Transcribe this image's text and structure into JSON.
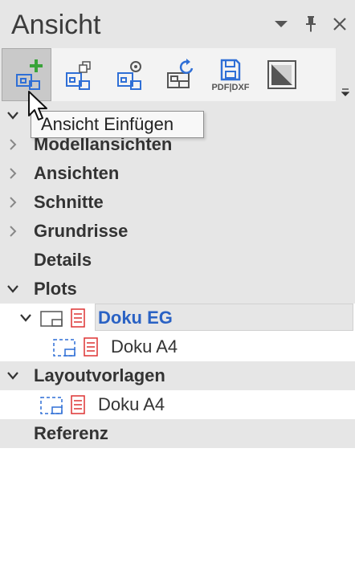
{
  "panel": {
    "title": "Ansicht",
    "controls": {
      "dropdown_icon": "chevron-down-icon",
      "pin_icon": "pin-icon",
      "close_icon": "close-icon"
    }
  },
  "toolbar": {
    "buttons": [
      {
        "name": "insert-view",
        "icon": "view-add-icon",
        "active": true
      },
      {
        "name": "copy-view",
        "icon": "view-copy-icon"
      },
      {
        "name": "view-settings",
        "icon": "view-settings-icon"
      },
      {
        "name": "refresh-view",
        "icon": "view-refresh-icon"
      },
      {
        "name": "export-pdf-dxf",
        "icon": "save-icon",
        "label": "PDF|DXF"
      },
      {
        "name": "view-style",
        "icon": "style-icon"
      }
    ]
  },
  "tooltip": {
    "text": "Ansicht Einfügen"
  },
  "tree": {
    "items": [
      {
        "label": "",
        "expanded": true
      },
      {
        "label": "Modellansichten",
        "expanded": false
      },
      {
        "label": "Ansichten",
        "expanded": false
      },
      {
        "label": "Schnitte",
        "expanded": false
      },
      {
        "label": "Grundrisse",
        "expanded": false
      },
      {
        "label": "Details"
      },
      {
        "label": "Plots",
        "expanded": true
      },
      {
        "label": "Doku EG",
        "selected": true,
        "expanded": true
      },
      {
        "label": "Doku A4"
      },
      {
        "label": "Layoutvorlagen",
        "expanded": true
      },
      {
        "label": "Doku A4"
      },
      {
        "label": "Referenz"
      }
    ]
  },
  "colors": {
    "accent": "#2a62c4",
    "header_bg": "#e6e6e6",
    "icon_blue": "#2f6fd6",
    "add_green": "#3aa33a"
  }
}
